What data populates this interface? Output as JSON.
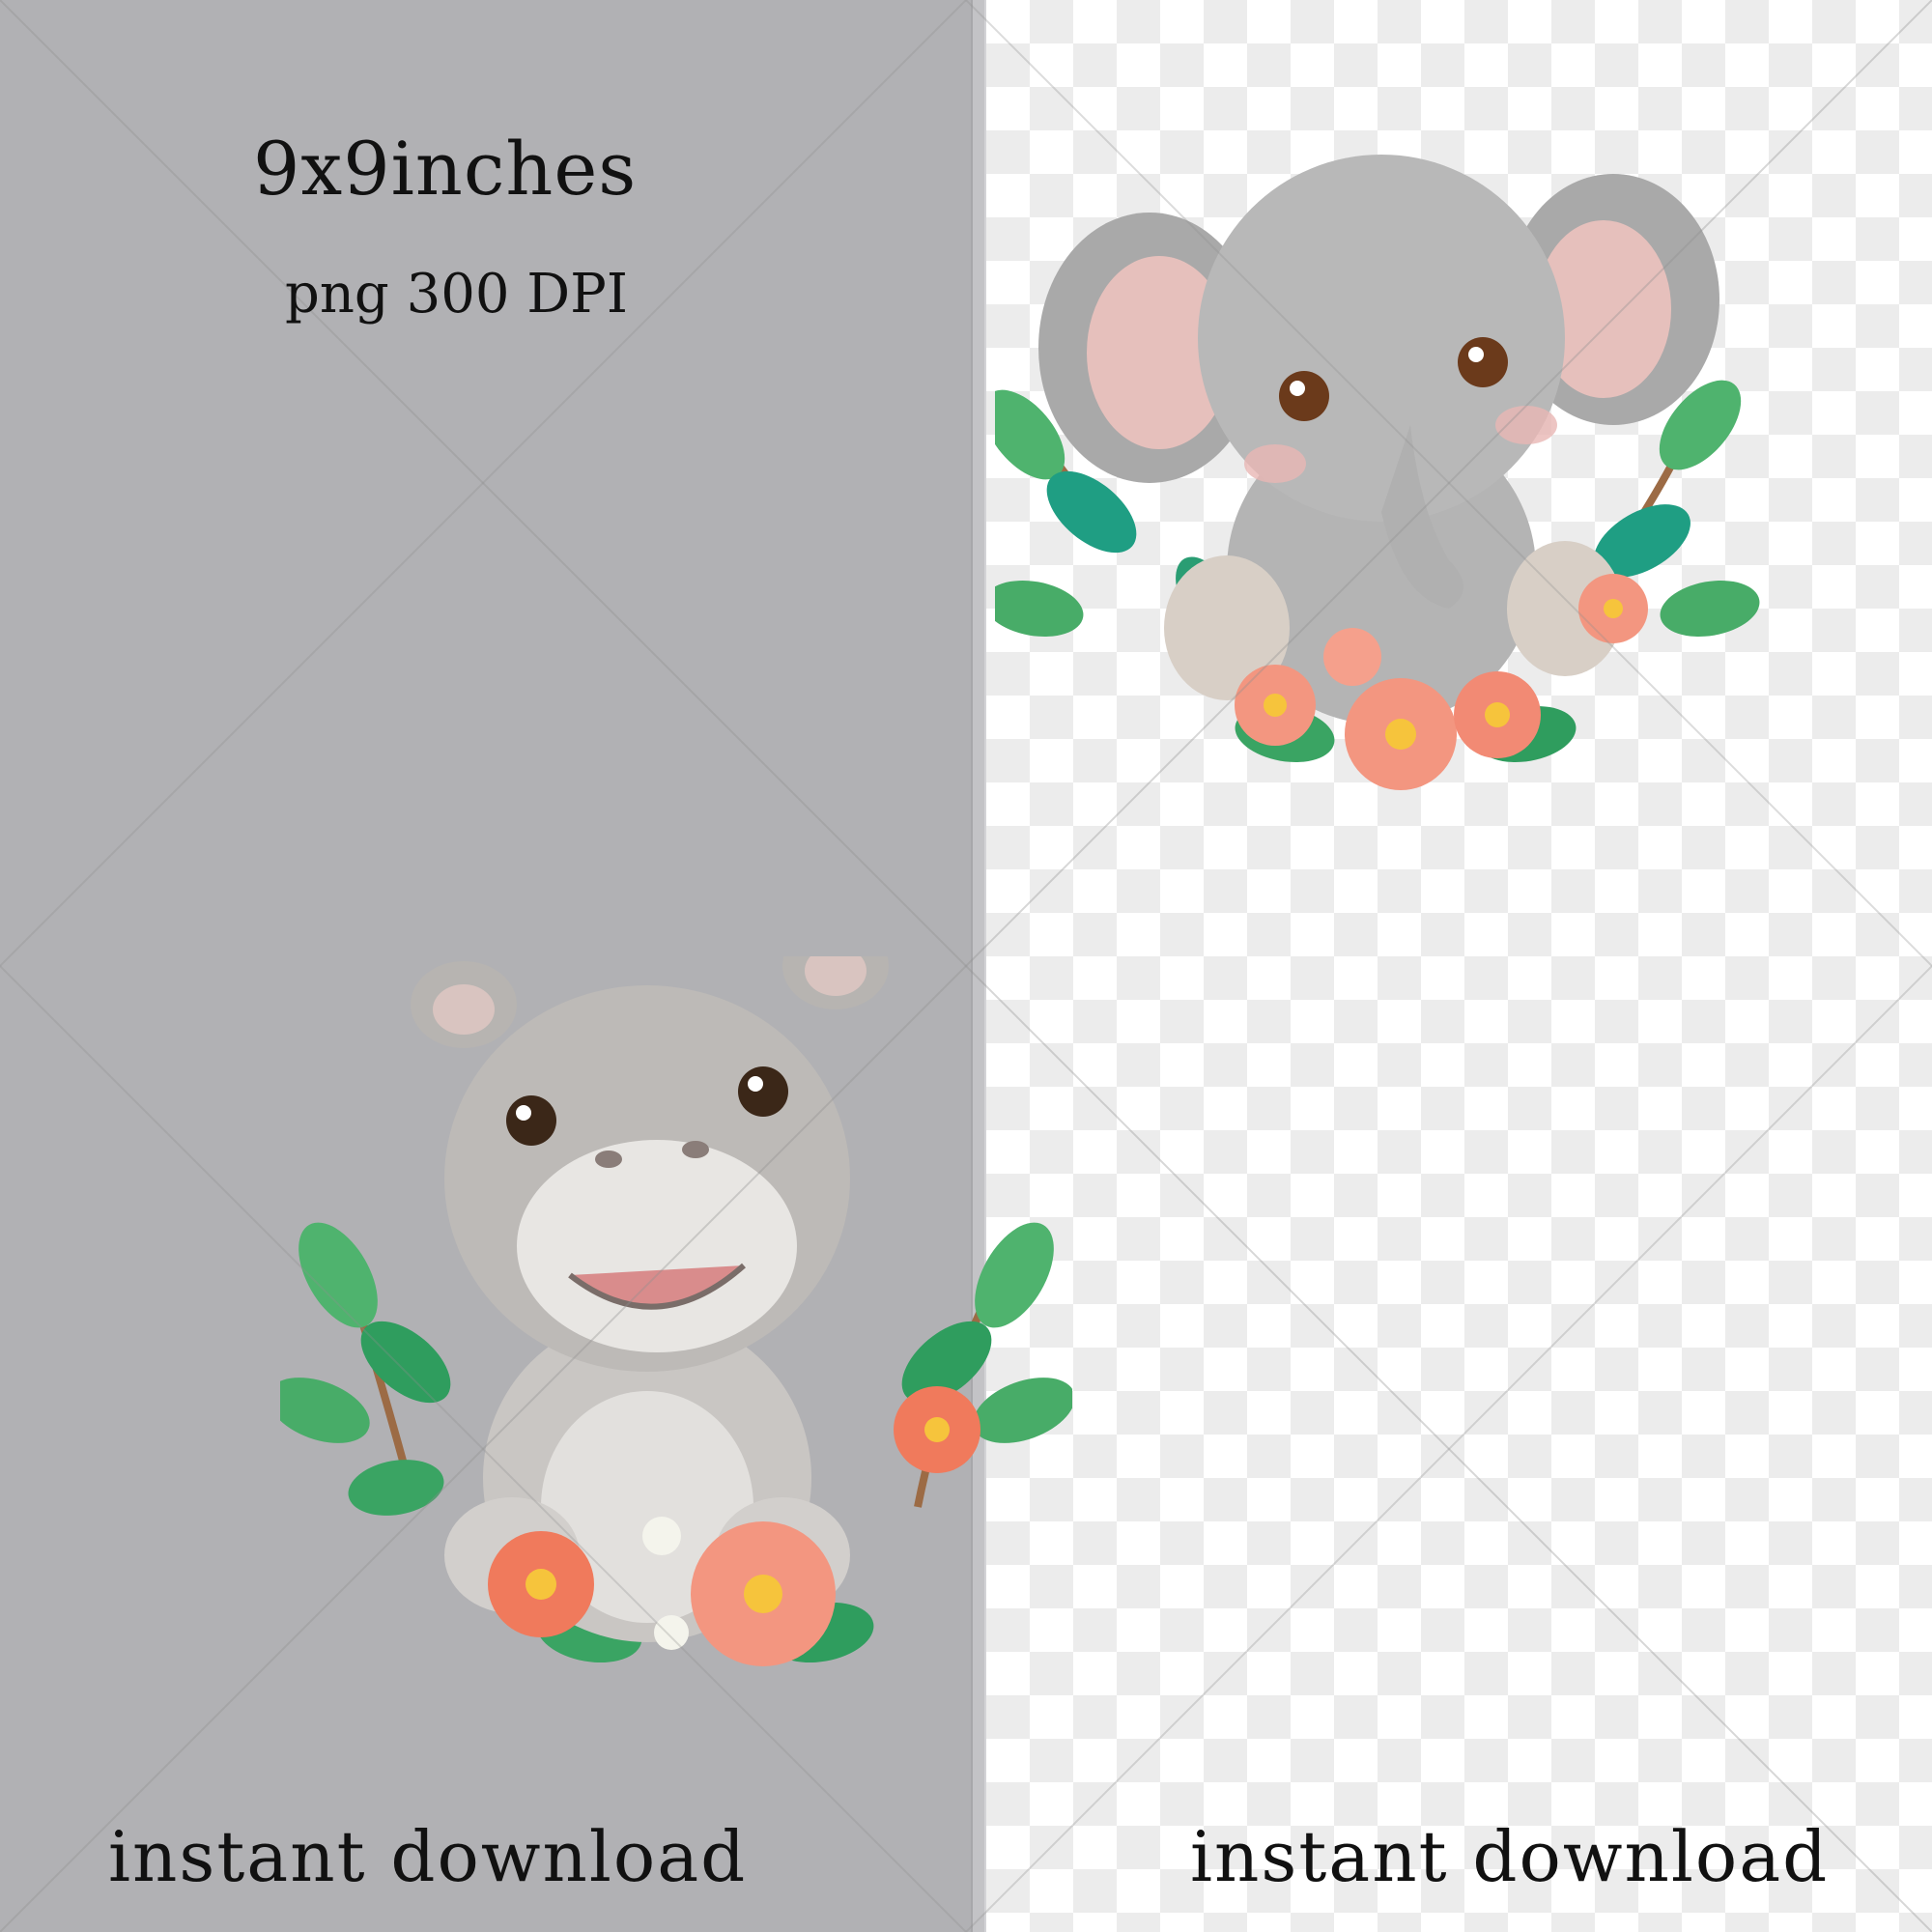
{
  "left_panel": {
    "size_text": "9x9inches",
    "format_text": "png 300 DPI",
    "download_text": "instant download",
    "background": "#b1b1b4"
  },
  "right_panel": {
    "download_text": "instant download",
    "background": "transparent-checkerboard"
  },
  "illustrations": {
    "left": "baby-hippo-with-flowers-illustration",
    "right": "baby-elephant-with-flowers-illustration"
  },
  "colors": {
    "leaf": "#3daa6a",
    "flower": "#f08a70",
    "animal_gray": "#b9b9b9"
  }
}
